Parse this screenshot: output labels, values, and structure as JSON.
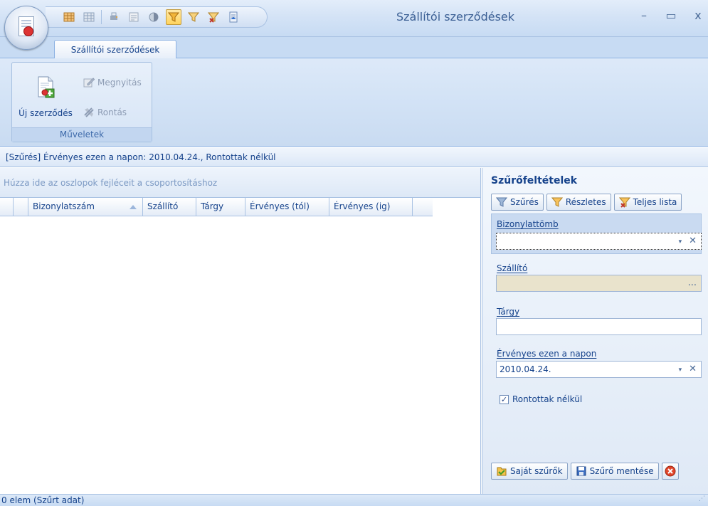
{
  "window": {
    "title": "Szállítói szerződések",
    "controls": {
      "minimize": "–",
      "maximize": "▭",
      "close": "x"
    }
  },
  "quick_access_toolbar": {
    "icons": [
      "grid-icon",
      "grid-disabled-icon",
      "print-icon",
      "export-icon",
      "toggle-icon",
      "filter-icon",
      "filter-detailed-icon",
      "filter-clear-icon",
      "report-icon"
    ]
  },
  "ribbon": {
    "tab": "Szállítói szerződések",
    "group_caption": "Műveletek",
    "new_button": "Új szerződés",
    "open_button": "Megnyitás",
    "void_button": "Rontás"
  },
  "filter_info": "[Szűrés]  Érvényes ezen a napon: 2010.04.24., Rontottak nélkül",
  "grid": {
    "group_panel_hint": "Húzza ide az oszlopok fejléceit a csoportosításhoz",
    "columns": [
      "Bizonylatszám",
      "Szállító",
      "Tárgy",
      "Érvényes (tól)",
      "Érvényes (ig)"
    ]
  },
  "filter_panel": {
    "title": "Szűrőfeltételek",
    "toolbar": {
      "filter": "Szűrés",
      "detailed": "Részletes",
      "full_list": "Teljes lista"
    },
    "fields": {
      "bizonylattomb": {
        "label_first": "B",
        "label_rest": "izonylattömb",
        "value": ""
      },
      "szallito": {
        "label_first": "S",
        "label_rest": "zállító",
        "value": "",
        "button": "..."
      },
      "targy": {
        "label_first": "T",
        "label_rest": "árgy",
        "value": ""
      },
      "ervenyes": {
        "label_first": "É",
        "label_rest": "rvényes ezen a napon",
        "value": "2010.04.24."
      }
    },
    "checkbox": {
      "label": "Rontottak nélkül",
      "checked": true,
      "mark": "✓"
    },
    "bottom": {
      "own_filters": "Saját szűrők",
      "save_filter": "Szűrő mentése"
    },
    "clear_glyph": "✕",
    "dropdown_glyph": "▾"
  },
  "status_bar": {
    "text": "0 elem (Szűrt adat)",
    "grip": "⋰"
  }
}
